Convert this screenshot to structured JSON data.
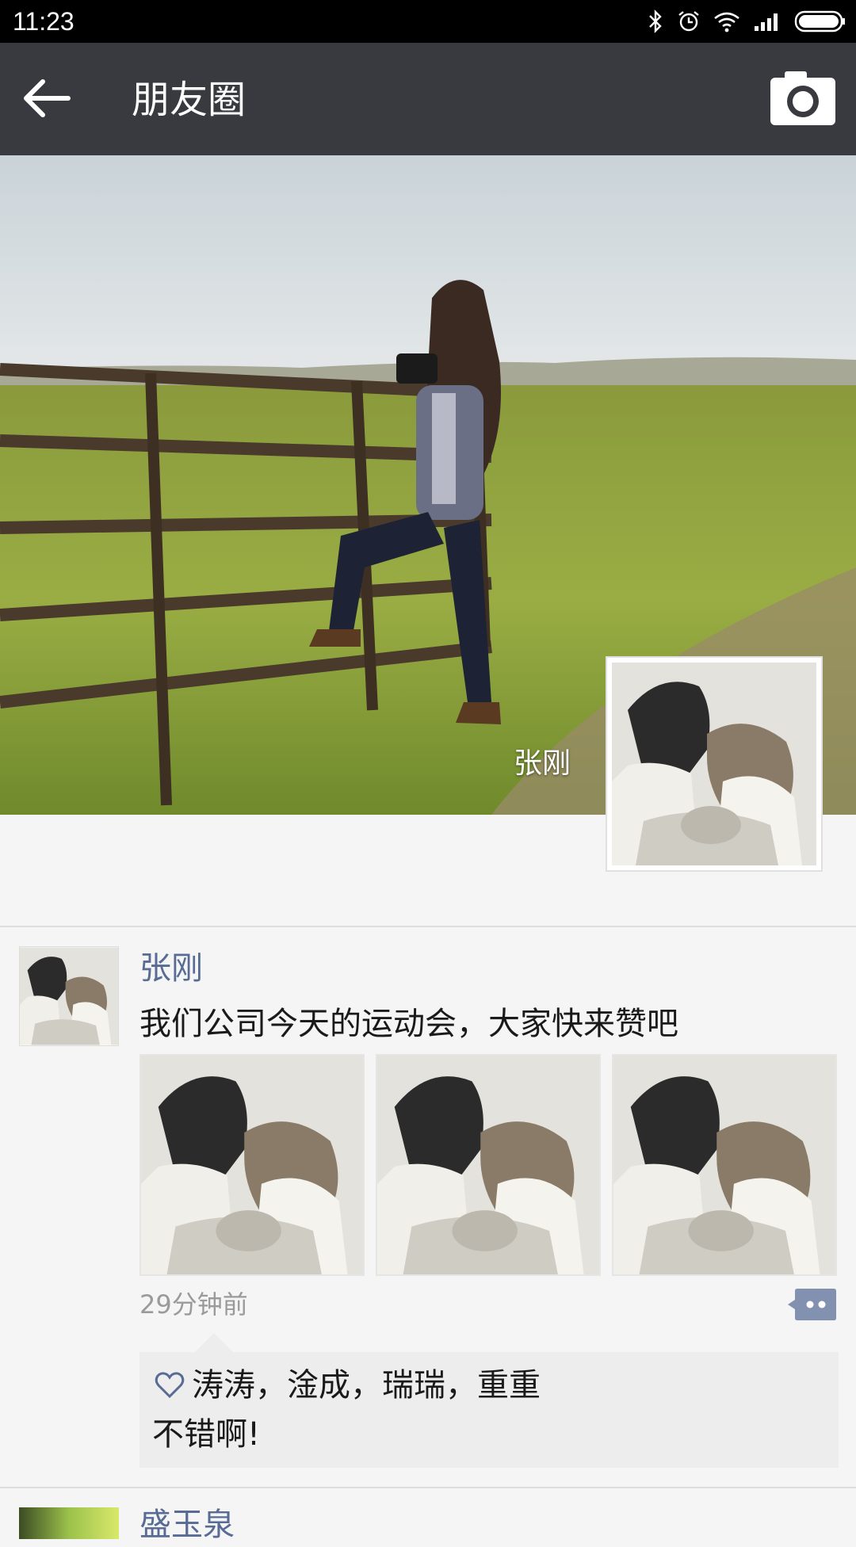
{
  "status_bar": {
    "time": "11:23",
    "icons": [
      "bluetooth-icon",
      "alarm-icon",
      "wifi-icon",
      "signal-icon",
      "battery-icon"
    ]
  },
  "header": {
    "title": "朋友圈",
    "back_icon": "arrow-left-icon",
    "camera_icon": "camera-icon",
    "background": "#393a3f"
  },
  "cover": {
    "user_name": "张刚"
  },
  "posts": [
    {
      "author": "张刚",
      "text": "我们公司今天的运动会，大家快来赞吧",
      "photo_count": 3,
      "time": "29分钟前",
      "likes": "涛涛，淦成，瑞瑞，重重",
      "comments": [
        "不错啊!"
      ]
    },
    {
      "author": "盛玉泉"
    }
  ],
  "colors": {
    "author_name": "#576b95",
    "page_background": "#f5f5f5",
    "likes_background": "#ededed"
  }
}
